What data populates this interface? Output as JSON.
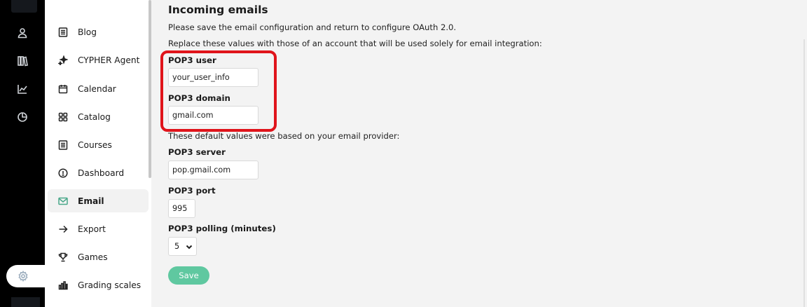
{
  "rail": {
    "icons": [
      "user-icon",
      "library-icon",
      "chart-line-icon",
      "pie-chart-icon"
    ],
    "active_icon": "settings-icon"
  },
  "sidebar": {
    "items": [
      {
        "label": "Blog",
        "icon": "document-list-icon"
      },
      {
        "label": "CYPHER Agent",
        "icon": "sparkle-icon"
      },
      {
        "label": "Calendar",
        "icon": "calendar-icon"
      },
      {
        "label": "Catalog",
        "icon": "grid-icon"
      },
      {
        "label": "Courses",
        "icon": "document-list-icon"
      },
      {
        "label": "Dashboard",
        "icon": "info-circle-icon"
      },
      {
        "label": "Email",
        "icon": "envelope-icon",
        "active": true
      },
      {
        "label": "Export",
        "icon": "arrow-right-icon"
      },
      {
        "label": "Games",
        "icon": "trophy-icon"
      },
      {
        "label": "Grading scales",
        "icon": "bar-chart-icon"
      }
    ]
  },
  "main": {
    "title": "Incoming emails",
    "note_save": "Please save the email configuration and return to configure OAuth 2.0.",
    "note_replace": "Replace these values with those of an account that will be used solely for email integration:",
    "pop3_user_label": "POP3 user",
    "pop3_user_value": "your_user_info",
    "pop3_domain_label": "POP3 domain",
    "pop3_domain_value": "gmail.com",
    "note_defaults": "These default values were based on your email provider:",
    "pop3_server_label": "POP3 server",
    "pop3_server_value": "pop.gmail.com",
    "pop3_port_label": "POP3 port",
    "pop3_port_value": "995",
    "pop3_polling_label": "POP3 polling (minutes)",
    "pop3_polling_value": "5",
    "save_label": "Save"
  },
  "colors": {
    "accent": "#5fc8a0",
    "highlight": "#e0141b",
    "rail": "#000000"
  }
}
